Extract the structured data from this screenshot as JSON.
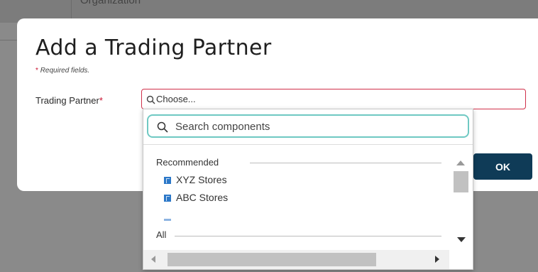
{
  "background": {
    "partial_text": "Organization"
  },
  "modal": {
    "title": "Add a Trading Partner",
    "required_star": "*",
    "required_note": "Required fields.",
    "field_label": "Trading Partner",
    "field_required_star": "*",
    "select_placeholder": "Choose...",
    "ok_label": "OK"
  },
  "dropdown": {
    "search_placeholder": "Search components",
    "groups": [
      {
        "header": "Recommended",
        "items": [
          {
            "label": "XYZ Stores",
            "icon": "component-icon"
          },
          {
            "label": "ABC Stores",
            "icon": "component-icon"
          }
        ]
      },
      {
        "header": "All",
        "items": []
      }
    ]
  },
  "colors": {
    "accent": "#0f3b57",
    "error_border": "#d0304a",
    "focus_border": "#6fc9c3",
    "component_icon": "#2c78c8",
    "required_star": "#c8102e"
  }
}
